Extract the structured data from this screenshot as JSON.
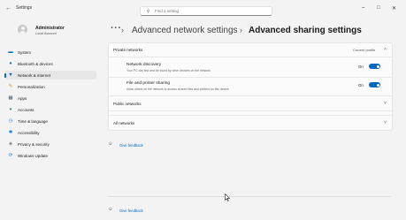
{
  "window": {
    "back_icon": "back-arrow-icon",
    "title": "Settings",
    "controls": {
      "minimize": "–",
      "maximize": "□",
      "close": "✕"
    }
  },
  "search": {
    "placeholder": "Find a setting",
    "icon": "search-icon"
  },
  "profile": {
    "name": "Administrator",
    "subtitle": "Local Account"
  },
  "sidebar": {
    "items": [
      {
        "label": "System",
        "icon": "monitor-icon",
        "color": "#0078d4",
        "active": false
      },
      {
        "label": "Bluetooth & devices",
        "icon": "bluetooth-icon",
        "color": "#0a6fcf",
        "active": false
      },
      {
        "label": "Network & internet",
        "icon": "wifi-icon",
        "color": "#1b5fa8",
        "active": true
      },
      {
        "label": "Personalization",
        "icon": "brush-icon",
        "color": "#e08a2c",
        "active": false
      },
      {
        "label": "Apps",
        "icon": "apps-icon",
        "color": "#4a5a6a",
        "active": false
      },
      {
        "label": "Accounts",
        "icon": "person-icon",
        "color": "#2aa46a",
        "active": false
      },
      {
        "label": "Time & language",
        "icon": "clock-globe-icon",
        "color": "#2b7bd6",
        "active": false
      },
      {
        "label": "Accessibility",
        "icon": "accessibility-icon",
        "color": "#1f7fd1",
        "active": false
      },
      {
        "label": "Privacy & security",
        "icon": "shield-icon",
        "color": "#7a7a7a",
        "active": false
      },
      {
        "label": "Windows Update",
        "icon": "update-icon",
        "color": "#0a74da",
        "active": false
      }
    ]
  },
  "breadcrumb": {
    "more": "···",
    "separator": "›",
    "parent": "Advanced network settings",
    "current": "Advanced sharing settings"
  },
  "private_networks": {
    "title": "Private networks",
    "status": "Current profile",
    "expanded": true,
    "rows": [
      {
        "title": "Network discovery",
        "description": "Your PC can find and be found by other devices on the network",
        "state_label": "On",
        "on": true
      },
      {
        "title": "File and printer sharing",
        "description": "Allow others on the network to access shared files and printers on this device",
        "state_label": "On",
        "on": true
      }
    ]
  },
  "public_networks": {
    "title": "Public networks",
    "expanded": false
  },
  "all_networks": {
    "title": "All networks",
    "expanded": false
  },
  "feedback": {
    "label": "Give feedback",
    "icon": "feedback-icon"
  },
  "footer_feedback": {
    "label": "Give feedback",
    "icon": "feedback-icon"
  },
  "colors": {
    "accent": "#0067c0",
    "background": "#f3f3f3",
    "card": "#fbfbfb"
  }
}
